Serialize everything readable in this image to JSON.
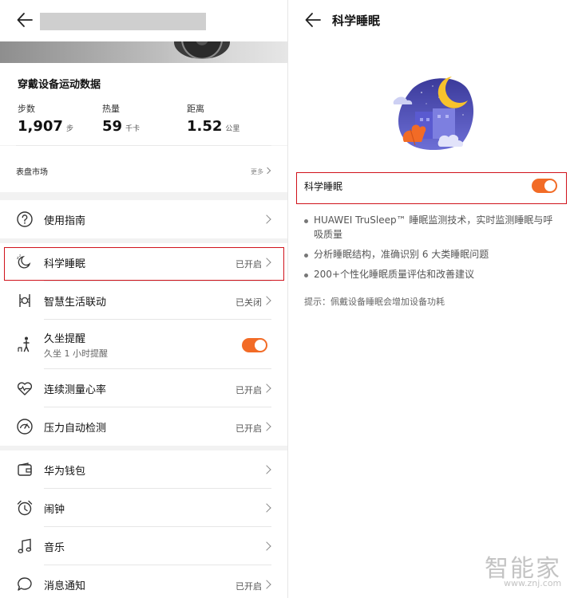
{
  "left": {
    "sport": {
      "title": "穿戴设备运动数据",
      "stats": [
        {
          "label": "步数",
          "value": "1,907",
          "unit": "步"
        },
        {
          "label": "热量",
          "value": "59",
          "unit": "千卡"
        },
        {
          "label": "距离",
          "value": "1.52",
          "unit": "公里"
        }
      ]
    },
    "dial": {
      "title": "表盘市场",
      "more": "更多"
    },
    "items": [
      {
        "icon": "help-circle-icon",
        "label": "使用指南",
        "status": ""
      },
      {
        "icon": "sleep-moon-icon",
        "label": "科学睡眠",
        "status": "已开启"
      },
      {
        "icon": "smart-life-icon",
        "label": "智慧生活联动",
        "status": "已关闭"
      },
      {
        "icon": "sedentary-person-icon",
        "label": "久坐提醒",
        "sub": "久坐 1 小时提醒",
        "toggle": true
      },
      {
        "icon": "heart-rate-icon",
        "label": "连续测量心率",
        "status": "已开启"
      },
      {
        "icon": "stress-gauge-icon",
        "label": "压力自动检测",
        "status": "已开启"
      },
      {
        "icon": "wallet-icon",
        "label": "华为钱包",
        "status": ""
      },
      {
        "icon": "alarm-clock-icon",
        "label": "闹钟",
        "status": ""
      },
      {
        "icon": "music-note-icon",
        "label": "音乐",
        "status": ""
      },
      {
        "icon": "message-bubble-icon",
        "label": "消息通知",
        "status": "已开启"
      }
    ]
  },
  "right": {
    "title": "科学睡眠",
    "switch_label": "科学睡眠",
    "switch_on": true,
    "bullets": [
      "HUAWEI TruSleep™ 睡眠监测技术，实时监测睡眠与呼吸质量",
      "分析睡眠结构，准确识别 6 大类睡眠问题",
      "200+个性化睡眠质量评估和改善建议"
    ],
    "tip": "提示：佩戴设备睡眠会增加设备功耗"
  },
  "watermark": {
    "text": "智能家",
    "url": "www.znj.com"
  },
  "colors": {
    "accent": "#f26b26",
    "highlight": "#d0121b"
  }
}
